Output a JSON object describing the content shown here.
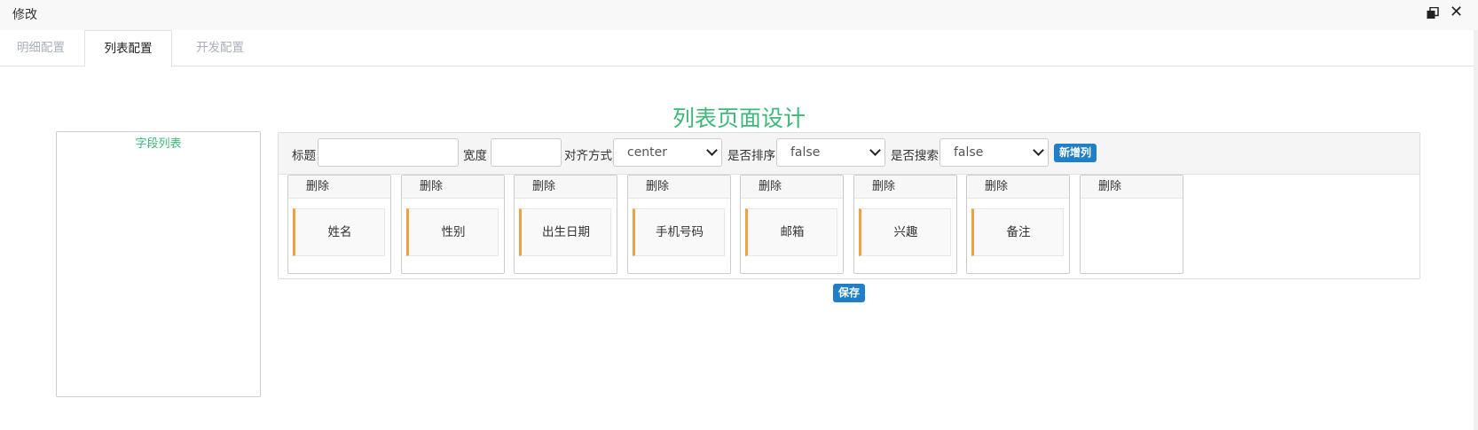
{
  "window": {
    "title": "修改"
  },
  "tabs": [
    {
      "label": "明细配置",
      "active": false
    },
    {
      "label": "列表配置",
      "active": true
    },
    {
      "label": "开发配置",
      "active": false
    }
  ],
  "page": {
    "title": "列表页面设计"
  },
  "field_panel": {
    "header": "字段列表"
  },
  "toolbar": {
    "title_label": "标题",
    "title_value": "",
    "width_label": "宽度",
    "width_value": "",
    "align_label": "对齐方式",
    "align_value": "center",
    "sort_label": "是否排序",
    "sort_value": "false",
    "search_label": "是否搜索",
    "search_value": "false",
    "add_column_label": "新增列"
  },
  "columns": [
    {
      "delete_label": "删除",
      "name": "姓名"
    },
    {
      "delete_label": "删除",
      "name": "性别"
    },
    {
      "delete_label": "删除",
      "name": "出生日期"
    },
    {
      "delete_label": "删除",
      "name": "手机号码"
    },
    {
      "delete_label": "删除",
      "name": "邮箱"
    },
    {
      "delete_label": "删除",
      "name": "兴趣"
    },
    {
      "delete_label": "删除",
      "name": "备注"
    },
    {
      "delete_label": "删除",
      "name": ""
    }
  ],
  "save_label": "保存",
  "colors": {
    "accent_green": "#3cb878",
    "button_blue": "#1f7fc7",
    "item_bar": "#f0a040"
  },
  "icons": {
    "restore": "restore-window-icon",
    "close": "close-icon",
    "select_arrow": "chevron-down-icon"
  }
}
